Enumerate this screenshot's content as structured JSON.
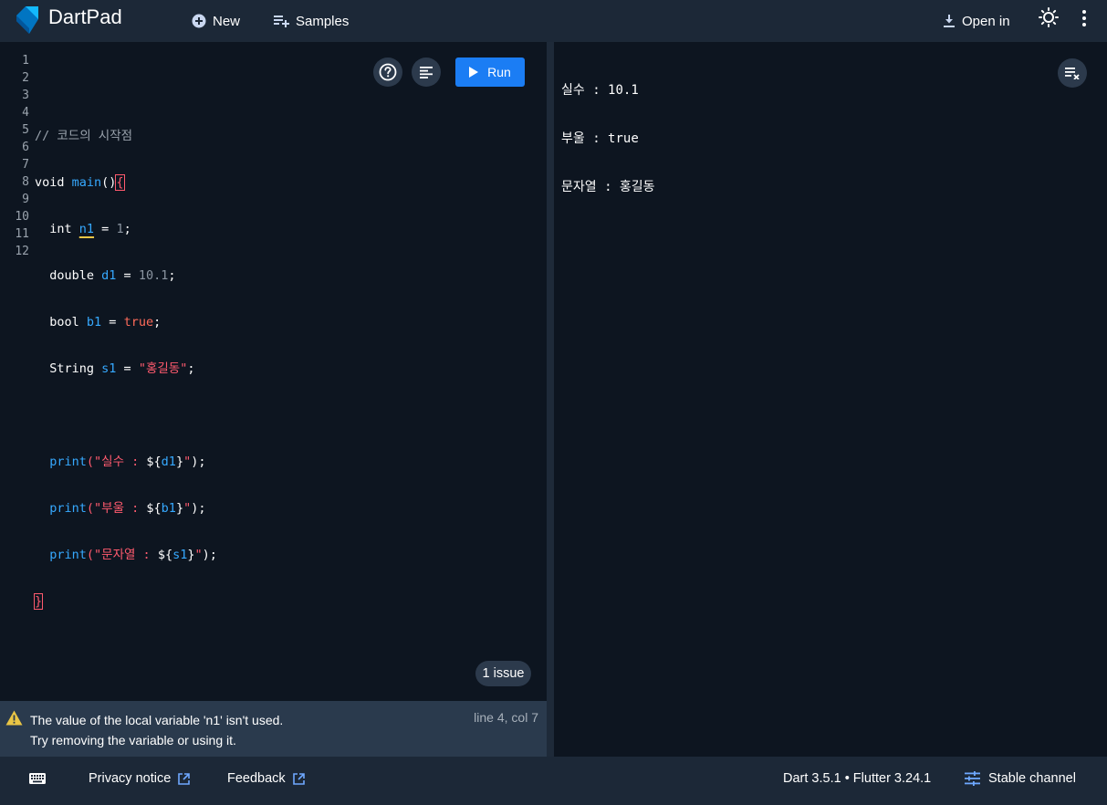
{
  "app": {
    "title": "DartPad"
  },
  "topbar": {
    "new_label": "New",
    "samples_label": "Samples",
    "open_in_label": "Open in"
  },
  "editor": {
    "run_label": "Run",
    "line_numbers": [
      "1",
      "2",
      "3",
      "4",
      "5",
      "6",
      "7",
      "8",
      "9",
      "10",
      "11",
      "12"
    ],
    "code": {
      "l2_comment": "// 코드의 시작점",
      "l3_void": "void ",
      "l3_main": "main",
      "l3_parens": "()",
      "l3_brace": "{",
      "l4_type": "  int ",
      "l4_var": "n1",
      "l4_eq": " = ",
      "l4_val": "1",
      "l4_end": ";",
      "l5_type": "  double ",
      "l5_var": "d1",
      "l5_eq": " = ",
      "l5_val": "10.1",
      "l5_end": ";",
      "l6_type": "  bool ",
      "l6_var": "b1",
      "l6_eq": " = ",
      "l6_val": "true",
      "l6_end": ";",
      "l7_type": "  String ",
      "l7_var": "s1",
      "l7_eq": " = ",
      "l7_val": "\"홍길동\"",
      "l7_end": ";",
      "l9_print": "  print",
      "l9_open": "(",
      "l9_str": "\"실수 : ",
      "l9_interp_open": "${",
      "l9_var": "d1",
      "l9_interp_close": "}",
      "l9_strend": "\"",
      "l9_close": ");",
      "l10_print": "  print",
      "l10_open": "(",
      "l10_str": "\"부울 : ",
      "l10_interp_open": "${",
      "l10_var": "b1",
      "l10_interp_close": "}",
      "l10_strend": "\"",
      "l10_close": ");",
      "l11_print": "  print",
      "l11_open": "(",
      "l11_str": "\"문자열 : ",
      "l11_interp_open": "${",
      "l11_var": "s1",
      "l11_interp_close": "}",
      "l11_strend": "\"",
      "l11_close": ");",
      "l12_brace": "}"
    },
    "issue_count_label": "1 issue"
  },
  "problems": {
    "message_line1": "The value of the local variable 'n1' isn't used.",
    "message_line2": "Try removing the variable or using it.",
    "location": "line 4, col 7"
  },
  "output": {
    "lines": [
      "실수 : 10.1",
      "부울 : true",
      "문자열 : 홍길동"
    ]
  },
  "statusbar": {
    "privacy_label": "Privacy notice",
    "feedback_label": "Feedback",
    "version_label": "Dart 3.5.1 • Flutter 3.24.1",
    "channel_label": "Stable channel"
  },
  "icons": {
    "logo": "dart-logo",
    "new": "add-circle-icon",
    "samples": "playlist-add-icon",
    "open_in": "download-icon",
    "theme": "sun-icon",
    "menu": "more-vert-icon",
    "help": "help-icon",
    "format": "format-align-icon",
    "run": "play-icon",
    "clear": "clear-all-icon",
    "warning": "warning-icon",
    "keyboard": "keyboard-icon",
    "external": "open-in-new-icon",
    "channel": "tune-icon"
  },
  "colors": {
    "accent": "#1b7df4",
    "string": "#ff5a6e",
    "identifier": "#36a9ff",
    "warning": "#e9c545"
  }
}
